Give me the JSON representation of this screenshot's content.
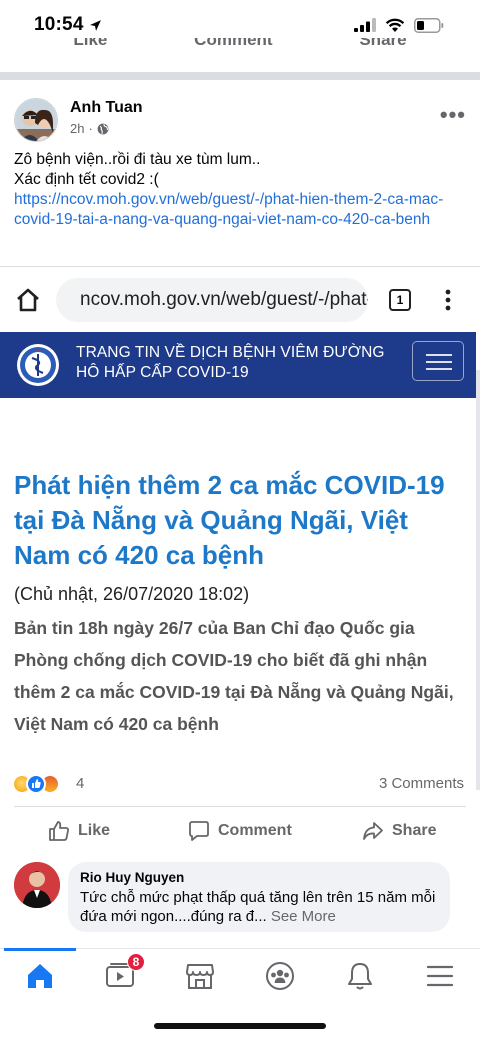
{
  "status_bar": {
    "time": "10:54"
  },
  "previous_post_actions": {
    "like": "Like",
    "comment": "Comment",
    "share": "Share"
  },
  "post": {
    "author": "Anh Tuan",
    "time": "2h",
    "text_line1": "Zô bệnh viện..rồi đi tàu xe tùm lum..",
    "text_line2": "Xác định tết covid2 :(",
    "link": "https://ncov.moh.gov.vn/web/guest/-/phat-hien-them-2-ca-mac-covid-19-tai-a-nang-va-quang-ngai-viet-nam-co-420-ca-benh"
  },
  "browser": {
    "url": "ncov.moh.gov.vn/web/guest/-/phat-hien",
    "tab_count": "1"
  },
  "site": {
    "title": "TRANG TIN VỀ DỊCH BỆNH VIÊM ĐƯỜNG HÔ HẤP CẤP COVID-19"
  },
  "article": {
    "title": "Phát hiện thêm 2 ca mắc COVID-19 tại Đà Nẵng và Quảng Ngãi, Việt Nam có 420 ca bệnh",
    "date": "(Chủ nhật, 26/07/2020 18:02)",
    "lead": "Bản tin 18h ngày 26/7 của Ban Chỉ đạo Quốc gia Phòng chống dịch COVID-19 cho biết đã ghi nhận thêm 2 ca mắc COVID-19 tại Đà Nẵng và Quảng Ngãi, Việt Nam có 420 ca bệnh"
  },
  "engagement": {
    "reaction_count": "4",
    "comments": "3 Comments",
    "reactions": [
      "sad",
      "like",
      "angry"
    ]
  },
  "actions": {
    "like": "Like",
    "comment": "Comment",
    "share": "Share"
  },
  "comment": {
    "author": "Rio Huy Nguyen",
    "text": "Tức chỗ mức phạt thấp quá tăng lên trên 15 năm mỗi đứa mới ngon....đúng ra đ...",
    "see_more": "See More"
  },
  "tabbar": {
    "tabs": [
      "home-icon",
      "watch-icon",
      "marketplace-icon",
      "groups-icon",
      "notifications-icon",
      "menu-icon"
    ],
    "watch_badge": "8",
    "active_tab": "home-icon"
  },
  "colors": {
    "facebook_blue": "#1877f2",
    "site_header": "#1e3a8a",
    "article_title": "#1e78c8",
    "link": "#216fdb",
    "badge": "#e41e3f"
  }
}
